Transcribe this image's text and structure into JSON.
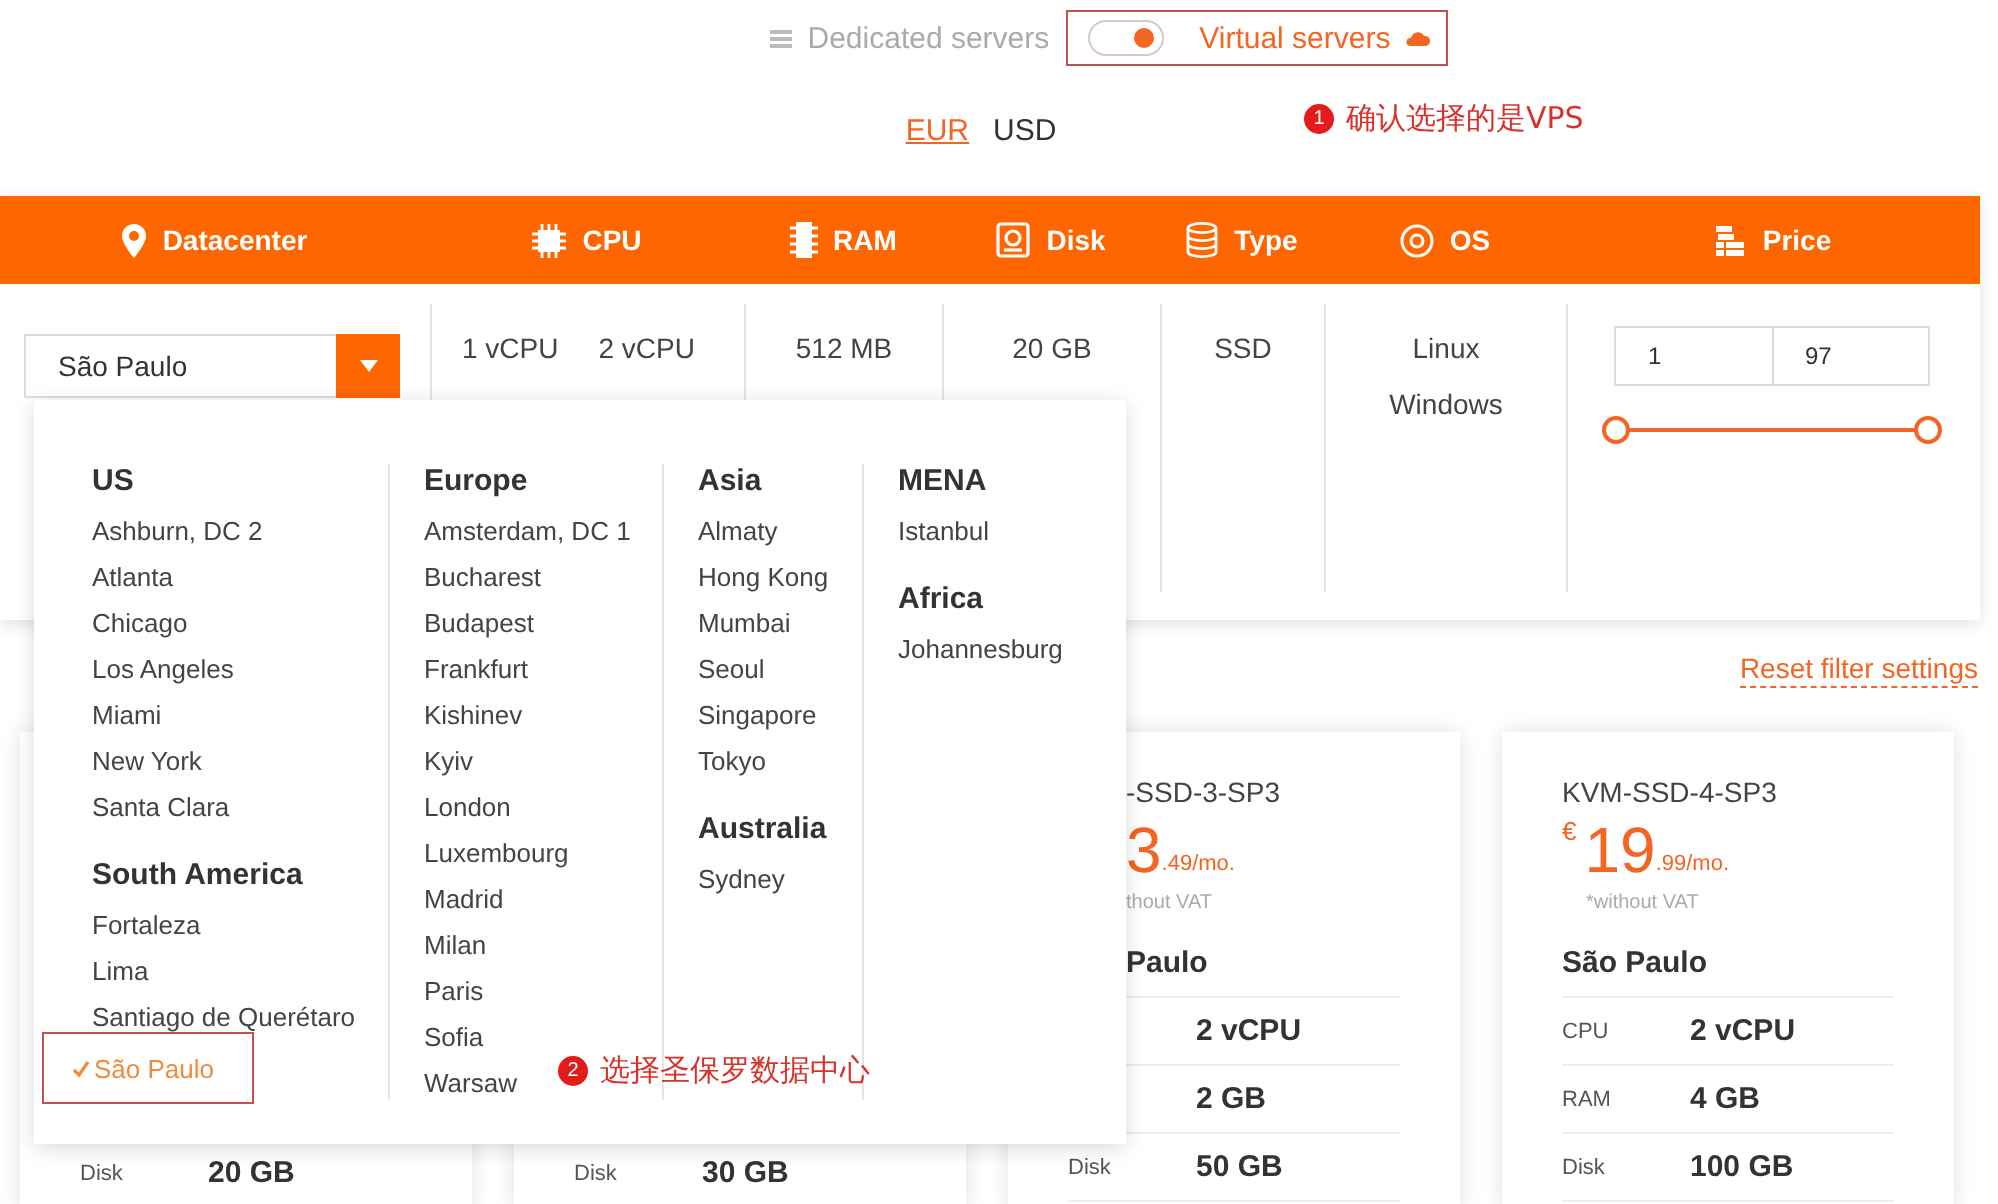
{
  "server_type": {
    "dedicated": {
      "label": "Dedicated servers"
    },
    "toggle": {
      "on": true
    },
    "virtual": {
      "label": "Virtual servers"
    }
  },
  "annotations": [
    {
      "number": "1",
      "text": "确认选择的是VPS"
    },
    {
      "number": "2",
      "text": "选择圣保罗数据中心"
    }
  ],
  "currencies": [
    {
      "label": "EUR",
      "selected": true
    },
    {
      "label": "USD",
      "selected": false
    }
  ],
  "filter": {
    "columns": [
      {
        "label": "Datacenter",
        "kind": "pin"
      },
      {
        "label": "CPU",
        "kind": "chip"
      },
      {
        "label": "RAM",
        "kind": "ram"
      },
      {
        "label": "Disk",
        "kind": "disk"
      },
      {
        "label": "Type",
        "kind": "database"
      },
      {
        "label": "OS",
        "kind": "disc"
      },
      {
        "label": "Price",
        "kind": "coins"
      }
    ],
    "datacenter_select": {
      "value": "São Paulo"
    },
    "cpu_options": [
      "1 vCPU",
      "2 vCPU"
    ],
    "ram_options": [
      "512 MB"
    ],
    "disk_options": [
      "20 GB"
    ],
    "type_options": [
      "SSD"
    ],
    "os_options": [
      "Linux",
      "Windows"
    ],
    "price": {
      "min": "1",
      "max": "97",
      "min_thumb": {
        "level": 0
      },
      "max_thumb": {
        "level": 1
      }
    }
  },
  "datacenter_menu": {
    "columns": [
      {
        "groups": [
          {
            "title": "US",
            "items": [
              {
                "label": "Ashburn, DC 2",
                "selected": false
              },
              {
                "label": "Atlanta",
                "selected": false
              },
              {
                "label": "Chicago",
                "selected": false
              },
              {
                "label": "Los Angeles",
                "selected": false
              },
              {
                "label": "Miami",
                "selected": false
              },
              {
                "label": "New York",
                "selected": false
              },
              {
                "label": "Santa Clara",
                "selected": false
              }
            ]
          },
          {
            "title": "South America",
            "items": [
              {
                "label": "Fortaleza",
                "selected": false
              },
              {
                "label": "Lima",
                "selected": false
              },
              {
                "label": "Santiago de Querétaro",
                "selected": false
              },
              {
                "label": "São Paulo",
                "selected": true
              }
            ]
          }
        ]
      },
      {
        "groups": [
          {
            "title": "Europe",
            "items": [
              {
                "label": "Amsterdam, DC 1",
                "selected": false
              },
              {
                "label": "Bucharest",
                "selected": false
              },
              {
                "label": "Budapest",
                "selected": false
              },
              {
                "label": "Frankfurt",
                "selected": false
              },
              {
                "label": "Kishinev",
                "selected": false
              },
              {
                "label": "Kyiv",
                "selected": false
              },
              {
                "label": "London",
                "selected": false
              },
              {
                "label": "Luxembourg",
                "selected": false
              },
              {
                "label": "Madrid",
                "selected": false
              },
              {
                "label": "Milan",
                "selected": false
              },
              {
                "label": "Paris",
                "selected": false
              },
              {
                "label": "Sofia",
                "selected": false
              },
              {
                "label": "Warsaw",
                "selected": false
              }
            ]
          }
        ]
      },
      {
        "groups": [
          {
            "title": "Asia",
            "items": [
              {
                "label": "Almaty",
                "selected": false
              },
              {
                "label": "Hong Kong",
                "selected": false
              },
              {
                "label": "Mumbai",
                "selected": false
              },
              {
                "label": "Seoul",
                "selected": false
              },
              {
                "label": "Singapore",
                "selected": false
              },
              {
                "label": "Tokyo",
                "selected": false
              }
            ]
          },
          {
            "title": "Australia",
            "items": [
              {
                "label": "Sydney",
                "selected": false
              }
            ]
          }
        ]
      },
      {
        "groups": [
          {
            "title": "MENA",
            "items": [
              {
                "label": "Istanbul",
                "selected": false
              }
            ]
          },
          {
            "title": "Africa",
            "items": [
              {
                "label": "Johannesburg",
                "selected": false
              }
            ]
          }
        ]
      }
    ]
  },
  "reset_link": "Reset filter settings",
  "plans": [
    {
      "kind": "covered",
      "specs": [
        {
          "label": "Disk",
          "value": "20 GB"
        }
      ]
    },
    {
      "kind": "covered",
      "specs": [
        {
          "label": "Disk",
          "value": "30 GB"
        }
      ]
    },
    {
      "kind": "partial",
      "name": "-SSD-3-SP3",
      "price": "3",
      "cents": ".49",
      "period": "/mo.",
      "vat": "thout VAT",
      "location": "Paulo",
      "specs": [
        {
          "value": "2 vCPU"
        },
        {
          "value": "2 GB"
        },
        {
          "label": "Disk",
          "value": "50 GB"
        }
      ]
    },
    {
      "kind": "full",
      "name": "KVM-SSD-4-SP3",
      "currency": "€",
      "price": "19",
      "cents": ".99",
      "period": "/mo.",
      "vat": "*without VAT",
      "location": "São Paulo",
      "specs": [
        {
          "label": "CPU",
          "value": "2 vCPU"
        },
        {
          "label": "RAM",
          "value": "4 GB"
        },
        {
          "label": "Disk",
          "value": "100 GB"
        }
      ]
    }
  ]
}
